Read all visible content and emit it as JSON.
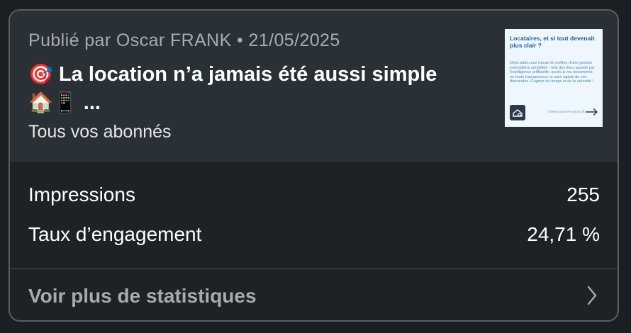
{
  "post": {
    "author": "Publié par Oscar FRANK",
    "separator": "•",
    "date": "21/05/2025",
    "title_emoji_start": "🎯",
    "title_text": "La location n’a jamais été aussi simple",
    "title_emoji_end": "🏠📱",
    "title_ellipsis": "...",
    "audience": "Tous vos abonnés"
  },
  "thumbnail": {
    "title": "Locataires, et si tout devenait plus clair ?",
    "body": "Dites adieu aux tracas et profitez d'une gestion immobilière simplifiée : état des lieux assisté par l'intelligence artificielle, accès à vos documents en toute transparence et suivi rapide de vos demandes. Gagnez du temps et de la sérénité !",
    "cta": "Glissez pour en savoir plus",
    "logo_icon": "house-key-icon",
    "arrow_icon": "arrow-right-icon",
    "colors": {
      "background": "#eef7fd",
      "title": "#1f5f9e",
      "body": "#4d87bd",
      "logo": "#2b3a4a"
    }
  },
  "stats": [
    {
      "label": "Impressions",
      "value": "255"
    },
    {
      "label": "Taux d’engagement",
      "value": "24,71 %"
    }
  ],
  "footer": {
    "label": "Voir plus de statistiques",
    "chevron_icon": "chevron-right-icon"
  },
  "colors": {
    "page_background": "#1b1f23",
    "card_header": "#293036",
    "card_body": "#1d2226",
    "card_border": "#5a5f64",
    "text_primary": "#ffffff",
    "text_secondary": "#a8acaf"
  }
}
